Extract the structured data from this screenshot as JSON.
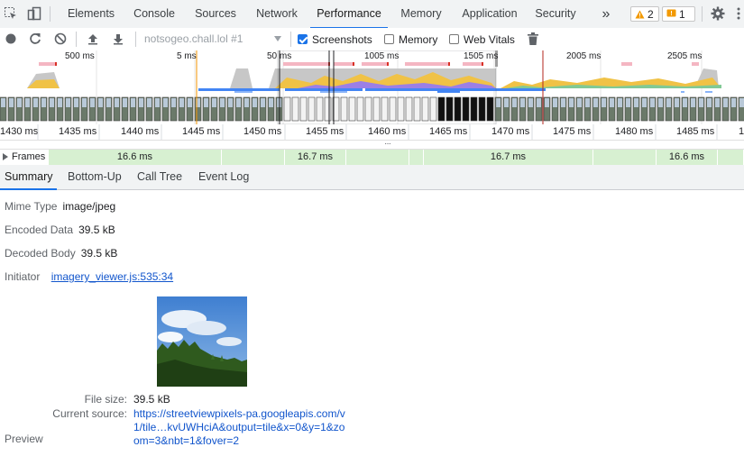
{
  "tabs": [
    {
      "label": "Elements"
    },
    {
      "label": "Console"
    },
    {
      "label": "Sources"
    },
    {
      "label": "Network"
    },
    {
      "label": "Performance"
    },
    {
      "label": "Memory"
    },
    {
      "label": "Application"
    },
    {
      "label": "Security"
    }
  ],
  "more_tabs": "»",
  "warnings_count": "2",
  "issues_count": "1",
  "toolbar": {
    "recording_select": "notsogeo.chall.lol #1",
    "screenshots_label": "Screenshots",
    "screenshots_checked": true,
    "memory_label": "Memory",
    "memory_checked": false,
    "webvitals_label": "Web Vitals",
    "webvitals_checked": false
  },
  "overview_labels": [
    "500 ms",
    "5 ms",
    "50 ms",
    "1005 ms",
    "1505 ms",
    "2005 ms",
    "2505 ms"
  ],
  "ruler_ticks": [
    "1430 ms",
    "1435 ms",
    "1440 ms",
    "1445 ms",
    "1450 ms",
    "1455 ms",
    "1460 ms",
    "1465 ms",
    "1470 ms",
    "1475 ms",
    "1480 ms",
    "1485 ms",
    "1"
  ],
  "frames": {
    "label": "Frames",
    "blocks": [
      "16.6 ms",
      "16.7 ms",
      "16.7 ms",
      "16.6 ms"
    ]
  },
  "subtabs": [
    {
      "label": "Summary"
    },
    {
      "label": "Bottom-Up"
    },
    {
      "label": "Call Tree"
    },
    {
      "label": "Event Log"
    }
  ],
  "details": {
    "mime_label": "Mime Type",
    "mime_value": "image/jpeg",
    "encoded_label": "Encoded Data",
    "encoded_value": "39.5 kB",
    "decoded_label": "Decoded Body",
    "decoded_value": "39.5 kB",
    "initiator_label": "Initiator",
    "initiator_value": "imagery_viewer.js:535:34",
    "filesize_label": "File size:",
    "filesize_value": "39.5 kB",
    "source_label": "Current source:",
    "source_line1": "https://streetviewpixels-pa.googleapis.com/v",
    "source_line2": "1/tile…kvUWHciA&output=tile&x=0&y=1&zo",
    "source_line3": "om=3&nbt=1&fover=2",
    "preview_label": "Preview"
  }
}
